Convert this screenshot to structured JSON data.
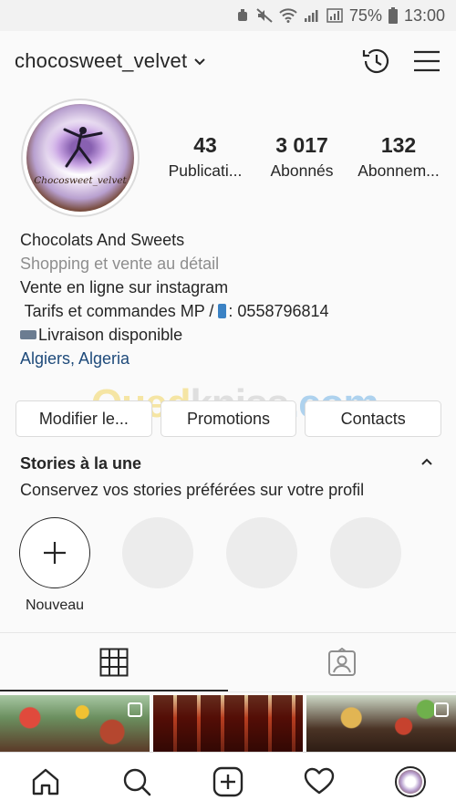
{
  "status_bar": {
    "battery_percent": "75%",
    "time": "13:00"
  },
  "header": {
    "username": "chocosweet_velvet"
  },
  "profile": {
    "avatar_brand_text": "Chocosweet_velvet",
    "stats": [
      {
        "value": "43",
        "label": "Publicati..."
      },
      {
        "value": "3 017",
        "label": "Abonnés"
      },
      {
        "value": "132",
        "label": "Abonnem..."
      }
    ],
    "bio": {
      "name": "Chocolats And Sweets",
      "category": "Shopping et vente au détail",
      "line1": "Vente en ligne sur instagram",
      "line2_prefix": " Tarifs et commandes MP / ",
      "line2_suffix": ": 0558796814",
      "line3": "Livraison disponible",
      "location": "Algiers, Algeria"
    }
  },
  "watermark": {
    "part1": "Oued",
    "part2": "kniss",
    "part3": ".com"
  },
  "buttons": {
    "edit": "Modifier le...",
    "promotions": "Promotions",
    "contacts": "Contacts"
  },
  "stories": {
    "title": "Stories à la une",
    "subtitle": "Conservez vos stories préférées sur votre profil",
    "new_label": "Nouveau"
  }
}
